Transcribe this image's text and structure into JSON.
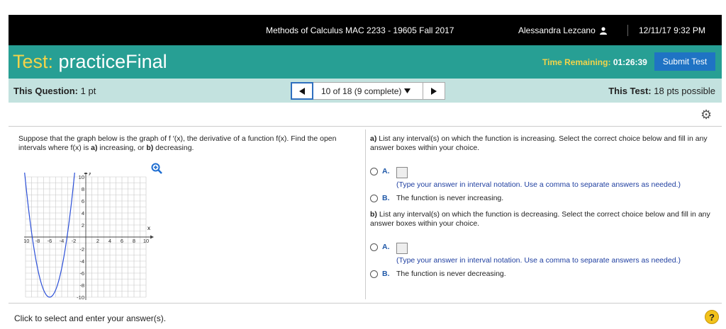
{
  "header": {
    "course": "Methods of Calculus MAC 2233 - 19605 Fall 2017",
    "user": "Alessandra Lezcano",
    "user_icon": "person-icon",
    "datetime": "12/11/17 9:32 PM"
  },
  "test": {
    "title_prefix": "Test:",
    "title_name": "practiceFinal",
    "time_label": "Time Remaining:",
    "time_value": "01:26:39",
    "submit_label": "Submit Test"
  },
  "question_bar": {
    "this_question_label": "This Question:",
    "this_question_value": "1 pt",
    "nav_text": "10 of 18 (9 complete)",
    "this_test_label": "This Test:",
    "this_test_value": "18 pts possible"
  },
  "question": {
    "intro_1": "Suppose that the graph below is the graph of f ′(x), the derivative of a function f(x). Find the open intervals where f(x) is ",
    "a_word": "a)",
    "increasing_text": " increasing, or ",
    "b_word": "b)",
    "decreasing_text": " decreasing."
  },
  "graph": {
    "x_axis_label": "x",
    "y_axis_label": "y",
    "x_ticks": [
      "-10",
      "-8",
      "-6",
      "-4",
      "-2",
      "2",
      "4",
      "6",
      "8",
      "10"
    ],
    "y_ticks": [
      "10",
      "8",
      "6",
      "4",
      "2",
      "-2",
      "-4",
      "-6",
      "-8",
      "-10"
    ],
    "curve_color": "#2b4fd8"
  },
  "part_a": {
    "prompt_label": "a)",
    "prompt": " List any interval(s) on which the function is increasing. Select the correct choice below and fill in any answer boxes within your choice.",
    "option_a_letter": "A.",
    "option_a_hint": "(Type your answer in interval notation. Use a comma to separate answers as needed.)",
    "option_b_letter": "B.",
    "option_b_text": "The function is never increasing."
  },
  "part_b": {
    "prompt_label": "b)",
    "prompt": " List any interval(s) on which the function is decreasing. Select the correct choice below and fill in any answer boxes within your choice.",
    "option_a_letter": "A.",
    "option_a_hint": "(Type your answer in interval notation. Use a comma to separate answers as needed.)",
    "option_b_letter": "B.",
    "option_b_text": "The function is never decreasing."
  },
  "footer": {
    "instruction": "Click to select and enter your answer(s).",
    "help_label": "?"
  }
}
